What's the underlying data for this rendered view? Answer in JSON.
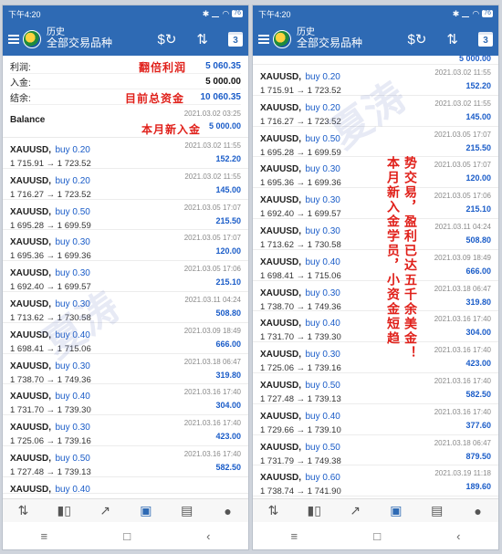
{
  "status": {
    "time": "下午4:20",
    "icons": [
      "bluetooth-icon",
      "mute-icon",
      "signal-icon",
      "wifi-icon"
    ],
    "battery": "76"
  },
  "appbar": {
    "sub_title": "历史",
    "title": "全部交易品种",
    "cal_day": "3"
  },
  "summary": [
    {
      "label": "利润:",
      "value": "5 060.35"
    },
    {
      "label": "入金:",
      "value": "5 000.00"
    },
    {
      "label": "结余:",
      "value": "10 060.35"
    }
  ],
  "annotations": {
    "profit_note": "翻倍利润",
    "balance_note": "目前总资金",
    "deposit_note": "本月新入金",
    "right_col1": "本月新入金学员，小资金短趋",
    "right_col2": "势交易，盈利已达五千余美金！"
  },
  "balance": {
    "label": "Balance",
    "date": "2021.03.02 03:25",
    "amount": "5 000.00"
  },
  "trades_left": [
    {
      "symbol": "XAUUSD,",
      "side": "buy 0.20",
      "open": "1 715.91",
      "close": "1 723.52",
      "date": "2021.03.02 11:55",
      "profit": "152.20"
    },
    {
      "symbol": "XAUUSD,",
      "side": "buy 0.20",
      "open": "1 716.27",
      "close": "1 723.52",
      "date": "2021.03.02 11:55",
      "profit": "145.00"
    },
    {
      "symbol": "XAUUSD,",
      "side": "buy 0.50",
      "open": "1 695.28",
      "close": "1 699.59",
      "date": "2021.03.05 17:07",
      "profit": "215.50"
    },
    {
      "symbol": "XAUUSD,",
      "side": "buy 0.30",
      "open": "1 695.36",
      "close": "1 699.36",
      "date": "2021.03.05 17:07",
      "profit": "120.00"
    },
    {
      "symbol": "XAUUSD,",
      "side": "buy 0.30",
      "open": "1 692.40",
      "close": "1 699.57",
      "date": "2021.03.05 17:06",
      "profit": "215.10"
    },
    {
      "symbol": "XAUUSD,",
      "side": "buy 0.30",
      "open": "1 713.62",
      "close": "1 730.58",
      "date": "2021.03.11 04:24",
      "profit": "508.80"
    },
    {
      "symbol": "XAUUSD,",
      "side": "buy 0.40",
      "open": "1 698.41",
      "close": "1 715.06",
      "date": "2021.03.09 18:49",
      "profit": "666.00"
    },
    {
      "symbol": "XAUUSD,",
      "side": "buy 0.30",
      "open": "1 738.70",
      "close": "1 749.36",
      "date": "2021.03.18 06:47",
      "profit": "319.80"
    },
    {
      "symbol": "XAUUSD,",
      "side": "buy 0.40",
      "open": "1 731.70",
      "close": "1 739.30",
      "date": "2021.03.16 17:40",
      "profit": "304.00"
    },
    {
      "symbol": "XAUUSD,",
      "side": "buy 0.30",
      "open": "1 725.06",
      "close": "1 739.16",
      "date": "2021.03.16 17:40",
      "profit": "423.00"
    },
    {
      "symbol": "XAUUSD,",
      "side": "buy 0.50",
      "open": "1 727.48",
      "close": "1 739.13",
      "date": "2021.03.16 17:40",
      "profit": "582.50"
    }
  ],
  "trade_left_partial": {
    "symbol": "XAUUSD,",
    "side": "buy 0.40"
  },
  "right_top_profit": "5 000.00",
  "trades_right": [
    {
      "symbol": "XAUUSD,",
      "side": "buy 0.20",
      "open": "1 715.91",
      "close": "1 723.52",
      "date": "2021.03.02 11:55",
      "profit": "152.20"
    },
    {
      "symbol": "XAUUSD,",
      "side": "buy 0.20",
      "open": "1 716.27",
      "close": "1 723.52",
      "date": "2021.03.02 11:55",
      "profit": "145.00"
    },
    {
      "symbol": "XAUUSD,",
      "side": "buy 0.50",
      "open": "1 695.28",
      "close": "1 699.59",
      "date": "2021.03.05 17:07",
      "profit": "215.50"
    },
    {
      "symbol": "XAUUSD,",
      "side": "buy 0.30",
      "open": "1 695.36",
      "close": "1 699.36",
      "date": "2021.03.05 17:07",
      "profit": "120.00"
    },
    {
      "symbol": "XAUUSD,",
      "side": "buy 0.30",
      "open": "1 692.40",
      "close": "1 699.57",
      "date": "2021.03.05 17:06",
      "profit": "215.10"
    },
    {
      "symbol": "XAUUSD,",
      "side": "buy 0.30",
      "open": "1 713.62",
      "close": "1 730.58",
      "date": "2021.03.11 04:24",
      "profit": "508.80"
    },
    {
      "symbol": "XAUUSD,",
      "side": "buy 0.40",
      "open": "1 698.41",
      "close": "1 715.06",
      "date": "2021.03.09 18:49",
      "profit": "666.00"
    },
    {
      "symbol": "XAUUSD,",
      "side": "buy 0.30",
      "open": "1 738.70",
      "close": "1 749.36",
      "date": "2021.03.18 06:47",
      "profit": "319.80"
    },
    {
      "symbol": "XAUUSD,",
      "side": "buy 0.40",
      "open": "1 731.70",
      "close": "1 739.30",
      "date": "2021.03.16 17:40",
      "profit": "304.00"
    },
    {
      "symbol": "XAUUSD,",
      "side": "buy 0.30",
      "open": "1 725.06",
      "close": "1 739.16",
      "date": "2021.03.16 17:40",
      "profit": "423.00"
    },
    {
      "symbol": "XAUUSD,",
      "side": "buy 0.50",
      "open": "1 727.48",
      "close": "1 739.13",
      "date": "2021.03.16 17:40",
      "profit": "582.50"
    },
    {
      "symbol": "XAUUSD,",
      "side": "buy 0.40",
      "open": "1 729.66",
      "close": "1 739.10",
      "date": "2021.03.16 17:40",
      "profit": "377.60"
    },
    {
      "symbol": "XAUUSD,",
      "side": "buy 0.50",
      "open": "1 731.79",
      "close": "1 749.38",
      "date": "2021.03.18 06:47",
      "profit": "879.50"
    },
    {
      "symbol": "XAUUSD,",
      "side": "buy 0.60",
      "open": "1 738.74",
      "close": "1 741.90",
      "date": "2021.03.19 11:18",
      "profit": "189.60"
    }
  ],
  "colors": {
    "accent": "#2e6ab4",
    "profit": "#1a5cc8",
    "annotation": "#e0201a"
  },
  "bottom_nav": [
    {
      "icon": "quotes-icon",
      "glyph": "⇅"
    },
    {
      "icon": "chart-icon",
      "glyph": "▮▯"
    },
    {
      "icon": "trade-icon",
      "glyph": "↗"
    },
    {
      "icon": "history-icon",
      "glyph": "▣",
      "active": true
    },
    {
      "icon": "news-icon",
      "glyph": "▤"
    },
    {
      "icon": "chat-icon",
      "glyph": "●"
    }
  ],
  "system_nav": [
    "≡",
    "□",
    "‹"
  ]
}
